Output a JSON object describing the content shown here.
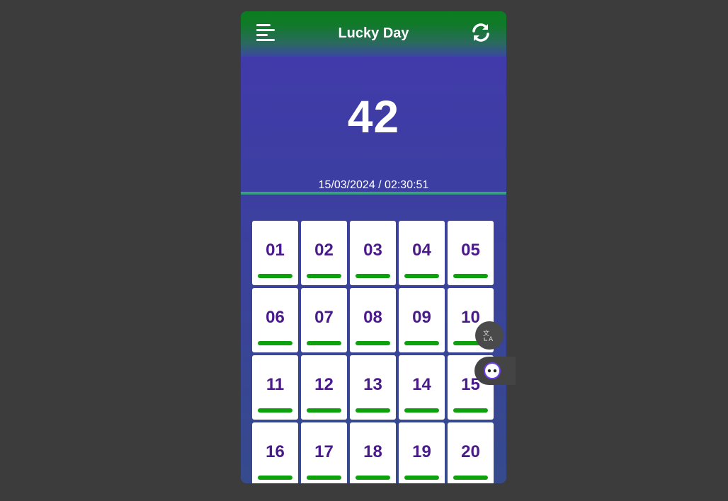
{
  "header": {
    "title": "Lucky Day",
    "menu_icon": "menu-icon",
    "refresh_icon": "refresh-icon"
  },
  "result": {
    "number": "42",
    "timestamp": "15/03/2024 / 02:30:51"
  },
  "numbers": [
    "01",
    "02",
    "03",
    "04",
    "05",
    "06",
    "07",
    "08",
    "09",
    "10",
    "11",
    "12",
    "13",
    "14",
    "15",
    "16",
    "17",
    "18",
    "19",
    "20"
  ],
  "floating": {
    "translate_icon": "translate-icon",
    "assistant_icon": "assistant-icon"
  },
  "colors": {
    "header_green": "#0b7d1f",
    "body_purple": "#4239ad",
    "card_text": "#4a1a8a",
    "bar_green": "#0ea10e"
  }
}
